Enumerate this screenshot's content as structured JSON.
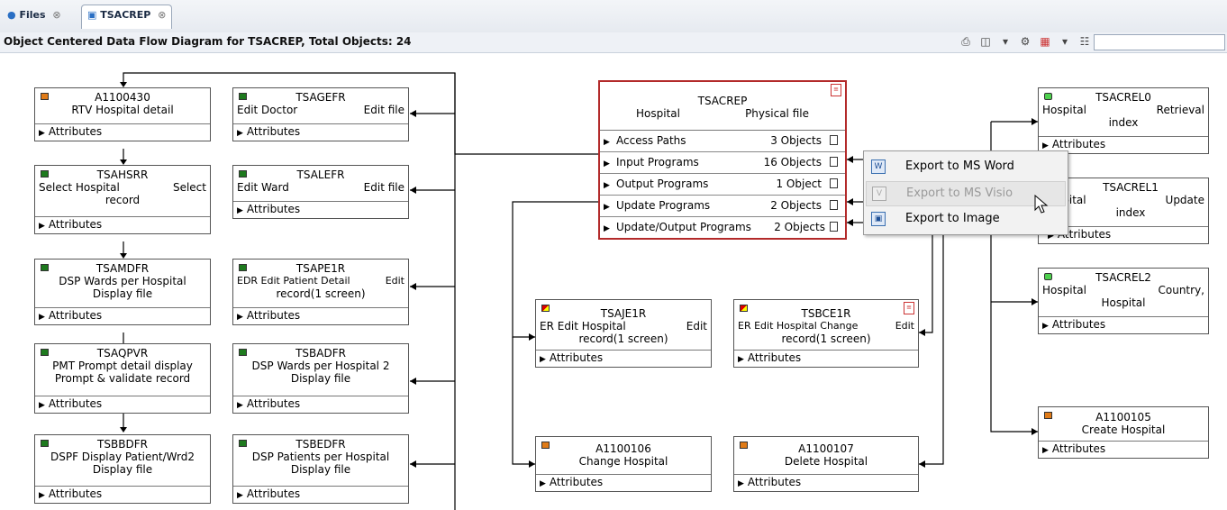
{
  "tabs": [
    {
      "label": "Files",
      "icon": "files-icon"
    },
    {
      "label": "TSACREP",
      "icon": "diagram-icon"
    }
  ],
  "view_title": "Object Centered Data Flow Diagram for TSACREP, Total Objects: 24",
  "toolbar": [
    "print-icon",
    "layout-icon",
    "dropdown-icon",
    "filter-icon",
    "color-icon",
    "dropdown-icon",
    "tree-icon"
  ],
  "attributes_label": "Attributes",
  "central": {
    "name": "TSACREP",
    "left": "Hospital",
    "right": "Physical file",
    "rows": [
      {
        "label": "Access Paths",
        "count": "3 Objects"
      },
      {
        "label": "Input Programs",
        "count": "16 Objects"
      },
      {
        "label": "Output Programs",
        "count": "1 Object"
      },
      {
        "label": "Update Programs",
        "count": "2 Objects"
      },
      {
        "label": "Update/Output Programs",
        "count": "2 Objects"
      }
    ]
  },
  "nodes": {
    "a1100430": {
      "name": "A1100430",
      "desc": "RTV Hospital detail",
      "color": "#e07b18"
    },
    "tsagefr": {
      "name": "TSAGEFR",
      "left": "Edit Doctor",
      "right": "Edit file",
      "color": "#1e7a1e"
    },
    "tsahsrr": {
      "name": "TSAHSRR",
      "left": "Select Hospital",
      "right": "Select",
      "desc2": "record",
      "color": "#1e7a1e"
    },
    "tsalefr": {
      "name": "TSALEFR",
      "left": "Edit Ward",
      "right": "Edit file",
      "color": "#1e7a1e"
    },
    "tsamdfr": {
      "name": "TSAMDFR",
      "desc": "DSP Wards per Hospital",
      "desc2": "Display file",
      "color": "#1e7a1e"
    },
    "tsape1r": {
      "name": "TSAPE1R",
      "left": "EDR Edit Patient Detail",
      "right": "Edit",
      "desc2": "record(1 screen)",
      "color": "#1e7a1e"
    },
    "tsaqpvr": {
      "name": "TSAQPVR",
      "desc": "PMT Prompt detail display",
      "desc2": "Prompt & validate record",
      "color": "#1e7a1e"
    },
    "tsbadfr": {
      "name": "TSBADFR",
      "desc": "DSP Wards per Hospital 2",
      "desc2": "Display file",
      "color": "#1e7a1e"
    },
    "tsbbdfr": {
      "name": "TSBBDFR",
      "desc": "DSPF Display Patient/Wrd2",
      "desc2": "Display file",
      "color": "#1e7a1e"
    },
    "tsbedfr": {
      "name": "TSBEDFR",
      "desc": "DSP Patients per Hospital",
      "desc2": "Display file",
      "color": "#1e7a1e"
    },
    "tsaje1r": {
      "name": "TSAJE1R",
      "left": "ER Edit Hospital",
      "right": "Edit",
      "desc2": "record(1 screen)"
    },
    "tsbce1r": {
      "name": "TSBCE1R",
      "left": "ER Edit Hospital Change",
      "right": "Edit",
      "desc2": "record(1 screen)"
    },
    "a1100106": {
      "name": "A1100106",
      "desc": "Change Hospital",
      "color": "#e07b18"
    },
    "a1100107": {
      "name": "A1100107",
      "desc": "Delete Hospital",
      "color": "#e07b18"
    },
    "tsacrel0": {
      "name": "TSACREL0",
      "left": "Hospital",
      "right": "Retrieval",
      "desc2": "index",
      "color": "#4ed04e"
    },
    "tsacrel1": {
      "name": "TSACREL1",
      "left": "spital",
      "right": "Update",
      "desc2": "index",
      "color": "#4ed04e"
    },
    "tsacrel2": {
      "name": "TSACREL2",
      "left": "Hospital",
      "right": "Country,",
      "desc2": "Hospital",
      "color": "#4ed04e"
    },
    "a1100105": {
      "name": "A1100105",
      "desc": "Create Hospital",
      "color": "#e07b18"
    }
  },
  "context_menu": [
    {
      "label": "Export to MS Word",
      "icon": "word-icon",
      "enabled": true
    },
    {
      "label": "Export to MS Visio",
      "icon": "visio-icon",
      "enabled": false
    },
    {
      "label": "Export to Image",
      "icon": "image-icon",
      "enabled": true
    }
  ]
}
